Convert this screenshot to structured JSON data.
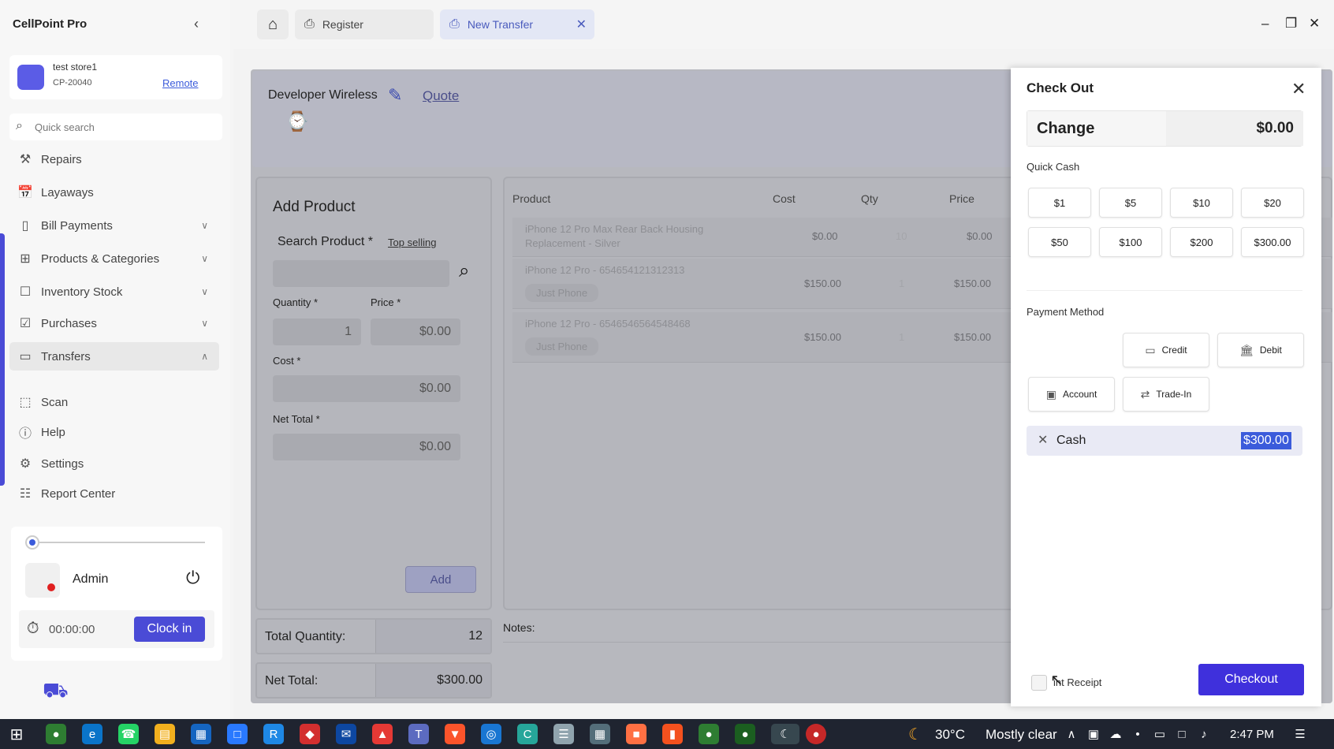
{
  "app": {
    "title": "CellPoint Pro",
    "collapse_icon": "chevron-left-icon"
  },
  "store": {
    "name": "test store1",
    "id": "CP-20040",
    "link": "Remote"
  },
  "search": {
    "placeholder": "Quick search"
  },
  "sidebar": {
    "items": [
      {
        "label": "Repairs",
        "icon": "wrench-icon"
      },
      {
        "label": "Layaways",
        "icon": "calendar-icon"
      },
      {
        "label": "Bill Payments",
        "icon": "phone-icon",
        "expandable": true
      },
      {
        "label": "Products & Categories",
        "icon": "grid-icon",
        "expandable": true
      },
      {
        "label": "Inventory Stock",
        "icon": "box-icon",
        "expandable": true
      },
      {
        "label": "Purchases",
        "icon": "cart-icon",
        "expandable": true
      },
      {
        "label": "Transfers",
        "icon": "card-icon",
        "expandable": true,
        "expanded": true
      },
      {
        "label": "Scan",
        "icon": "scan-icon"
      },
      {
        "label": "Help",
        "icon": "help-icon"
      },
      {
        "label": "Settings",
        "icon": "gear-icon"
      },
      {
        "label": "Report Center",
        "icon": "report-icon"
      }
    ]
  },
  "user": {
    "name": "Admin",
    "timer": "00:00:00",
    "clock_in_label": "Clock in"
  },
  "tabs": {
    "register": "Register",
    "new_transfer": "New Transfer"
  },
  "transfer": {
    "customer": "Developer Wireless",
    "quote_link": "Quote",
    "add_product": {
      "title": "Add Product",
      "search_label": "Search Product *",
      "top_selling": "Top selling",
      "quantity_label": "Quantity *",
      "quantity_value": "1",
      "price_label": "Price *",
      "price_value": "$0.00",
      "cost_label": "Cost *",
      "cost_value": "$0.00",
      "net_total_label": "Net Total *",
      "net_total_value": "$0.00",
      "add_button": "Add"
    },
    "table": {
      "headers": [
        "Product",
        "Cost",
        "Qty",
        "Price"
      ],
      "rows": [
        {
          "name_line1": "iPhone 12 Pro Max Rear Back Housing",
          "name_line2": "Replacement - Silver",
          "cost": "$0.00",
          "qty": "10",
          "price": "$0.00",
          "tag": ""
        },
        {
          "name_line1": "iPhone 12 Pro - 654654121312313",
          "name_line2": "",
          "cost": "$150.00",
          "qty": "1",
          "price": "$150.00",
          "tag": "Just Phone"
        },
        {
          "name_line1": "iPhone 12 Pro - 6546546564548468",
          "name_line2": "",
          "cost": "$150.00",
          "qty": "1",
          "price": "$150.00",
          "tag": "Just Phone"
        }
      ]
    },
    "totals": {
      "quantity_label": "Total Quantity:",
      "quantity_value": "12",
      "net_label": "Net Total:",
      "net_value": "$300.00"
    },
    "notes_label": "Notes:"
  },
  "checkout": {
    "title": "Check Out",
    "change_label": "Change",
    "change_value": "$0.00",
    "quick_cash_label": "Quick Cash",
    "quick_cash": [
      "$1",
      "$5",
      "$10",
      "$20",
      "$50",
      "$100",
      "$200",
      "$300.00"
    ],
    "payment_method_label": "Payment Method",
    "methods": {
      "credit": "Credit",
      "debit": "Debit",
      "account": "Account",
      "trade_in": "Trade-In"
    },
    "cash_label": "Cash",
    "cash_value": "$300.00",
    "print_receipt": "int Receipt",
    "checkout_button": "Checkout"
  },
  "taskbar": {
    "temperature": "30°C",
    "weather": "Mostly clear",
    "time": "2:47 PM"
  },
  "colors": {
    "accent": "#4a4bd6",
    "checkout": "#3f30dc",
    "highlight": "#3b5bdb"
  }
}
